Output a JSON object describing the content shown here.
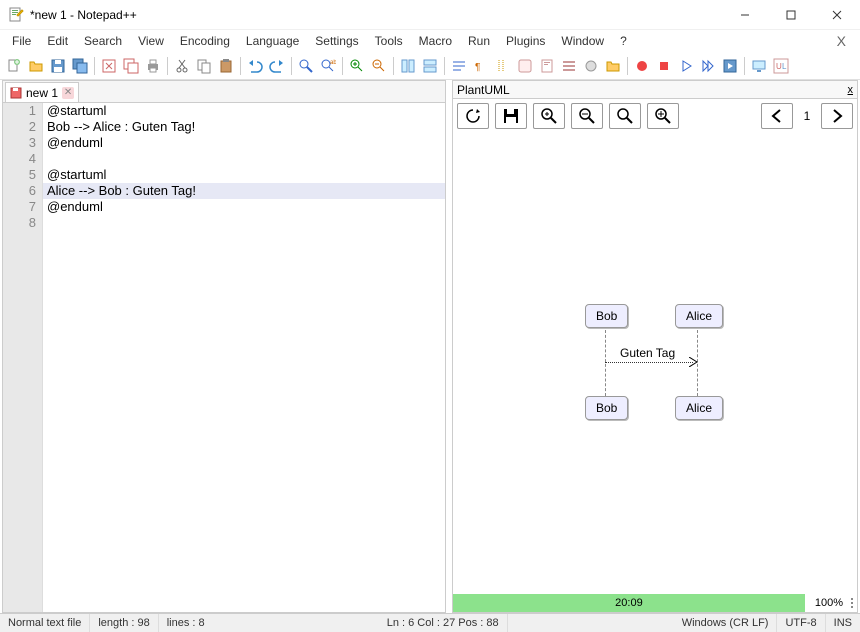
{
  "window": {
    "title": "*new 1 - Notepad++"
  },
  "menu": {
    "items": [
      "File",
      "Edit",
      "Search",
      "View",
      "Encoding",
      "Language",
      "Settings",
      "Tools",
      "Macro",
      "Run",
      "Plugins",
      "Window",
      "?"
    ]
  },
  "tab": {
    "label": "new 1"
  },
  "editor": {
    "lines": [
      "@startuml",
      "Bob --> Alice : Guten Tag!",
      "@enduml",
      "",
      "@startuml",
      "Alice --> Bob : Guten Tag!",
      "@enduml",
      ""
    ],
    "highlight_line": 6
  },
  "panel": {
    "title": "PlantUML",
    "page": "1",
    "progress": {
      "time": "20:09",
      "pct": "100%"
    }
  },
  "diagram": {
    "actor1": "Bob",
    "actor2": "Alice",
    "msg": "Guten Tag"
  },
  "status": {
    "filetype": "Normal text file",
    "length": "length : 98",
    "lines": "lines : 8",
    "pos": "Ln : 6    Col : 27    Pos : 88",
    "eol": "Windows (CR LF)",
    "enc": "UTF-8",
    "mode": "INS"
  }
}
